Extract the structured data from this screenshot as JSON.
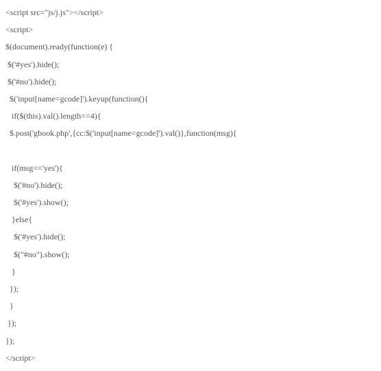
{
  "code_lines": [
    "<script src=\"js/j.js\"></script>",
    "<script>",
    "$(document).ready(function(e) {",
    " $('#yes').hide();",
    " $('#no').hide();",
    "  $('input[name=gcode]').keyup(function(){",
    "   if($(this).val().length==4){",
    "  $.post('gbook.php',{cc:$('input[name=gcode]').val()},function(msg){",
    "   ",
    "   if(msg=='yes'){",
    "    $('#no').hide();",
    "    $('#yes').show();",
    "   }else{",
    "    $('#yes').hide();",
    "    $(\"#no\").show();",
    "   }",
    "  });",
    "  }",
    " });",
    "});",
    "</script>"
  ]
}
